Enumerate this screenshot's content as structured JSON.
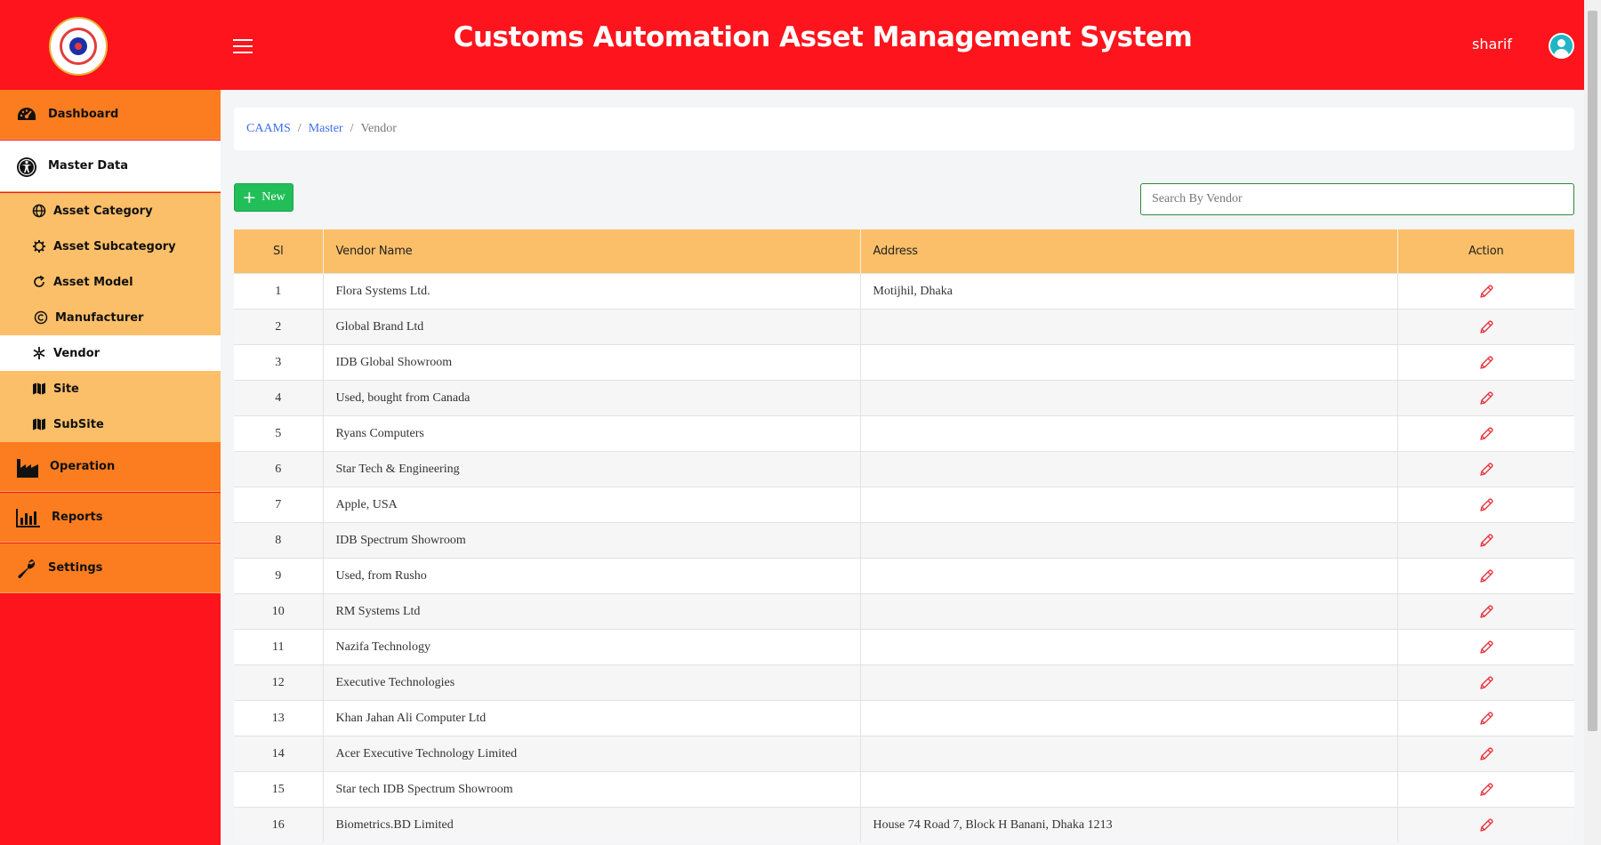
{
  "header": {
    "title": "Customs Automation Asset Management System",
    "user_name": "sharif",
    "bg_color": "#fd141c"
  },
  "sidebar": {
    "items": [
      {
        "label": "Dashboard",
        "icon": "dashboard-icon"
      },
      {
        "label": "Master Data",
        "icon": "universal-access-icon",
        "active": true
      },
      {
        "label": "Asset Category",
        "icon": "globe-icon",
        "sub": true
      },
      {
        "label": "Asset Subcategory",
        "icon": "gear-icon",
        "sub": true
      },
      {
        "label": "Asset Model",
        "icon": "refresh-icon",
        "sub": true
      },
      {
        "label": "Manufacturer",
        "icon": "copyright-icon",
        "sub": true
      },
      {
        "label": "Vendor",
        "icon": "snowflake-icon",
        "sub": true,
        "active": true
      },
      {
        "label": "Site",
        "icon": "map-icon",
        "sub": true
      },
      {
        "label": "SubSite",
        "icon": "map-icon",
        "sub": true
      },
      {
        "label": "Operation",
        "icon": "industry-icon"
      },
      {
        "label": "Reports",
        "icon": "bar-chart-icon"
      },
      {
        "label": "Settings",
        "icon": "wrench-icon"
      }
    ]
  },
  "breadcrumb": {
    "items": [
      "CAAMS",
      "Master"
    ],
    "current": "Vendor"
  },
  "toolbar": {
    "new_label": "New",
    "search_placeholder": "Search By Vendor"
  },
  "table": {
    "columns": [
      "Sl",
      "Vendor Name",
      "Address",
      "Action"
    ],
    "rows": [
      {
        "sl": "1",
        "name": "Flora Systems Ltd.",
        "address": "Motijhil, Dhaka"
      },
      {
        "sl": "2",
        "name": "Global Brand Ltd",
        "address": ""
      },
      {
        "sl": "3",
        "name": "IDB Global Showroom",
        "address": ""
      },
      {
        "sl": "4",
        "name": "Used, bought from Canada",
        "address": ""
      },
      {
        "sl": "5",
        "name": "Ryans Computers",
        "address": ""
      },
      {
        "sl": "6",
        "name": "Star Tech & Engineering",
        "address": ""
      },
      {
        "sl": "7",
        "name": "Apple, USA",
        "address": ""
      },
      {
        "sl": "8",
        "name": "IDB Spectrum Showroom",
        "address": ""
      },
      {
        "sl": "9",
        "name": "Used, from Rusho",
        "address": ""
      },
      {
        "sl": "10",
        "name": "RM Systems Ltd",
        "address": ""
      },
      {
        "sl": "11",
        "name": "Nazifa Technology",
        "address": ""
      },
      {
        "sl": "12",
        "name": "Executive Technologies",
        "address": ""
      },
      {
        "sl": "13",
        "name": "Khan Jahan Ali Computer Ltd",
        "address": ""
      },
      {
        "sl": "14",
        "name": "Acer Executive Technology Limited",
        "address": ""
      },
      {
        "sl": "15",
        "name": "Star tech IDB Spectrum Showroom",
        "address": ""
      },
      {
        "sl": "16",
        "name": "Biometrics.BD Limited",
        "address": "House 74 Road 7, Block H Banani, Dhaka 1213"
      }
    ],
    "action_icon": "pencil-icon"
  },
  "colors": {
    "primary_red": "#fd141c",
    "nav_orange": "#fc7d1f",
    "submenu_orange": "#fcbf69",
    "new_button_green": "#22bf58",
    "link_blue": "#3c6ee8",
    "edit_icon_red": "#e8323c"
  }
}
